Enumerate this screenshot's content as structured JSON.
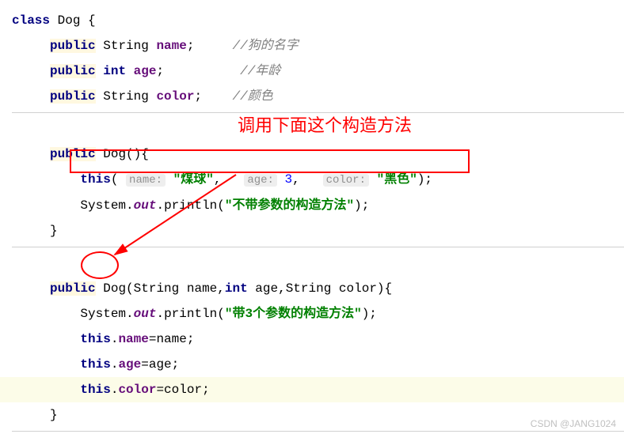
{
  "code": {
    "classDecl": {
      "kw_class": "class",
      "name": "Dog",
      "brace": " {"
    },
    "field1": {
      "pub": "public",
      "type": "String",
      "name": "name",
      "semi": ";",
      "comment": "//狗的名字"
    },
    "field2": {
      "pub": "public",
      "type": "int",
      "name": "age",
      "semi": ";",
      "comment": "//年龄"
    },
    "field3": {
      "pub": "public",
      "type": "String",
      "name": "color",
      "semi": ";",
      "comment": "//颜色"
    },
    "ctor1": {
      "pub": "public",
      "name": "Dog",
      "paren": "(){",
      "thisCall": {
        "kw_this": "this",
        "open": "(",
        "h1": "name:",
        "arg1": "\"煤球\"",
        "c1": ",",
        "h2": "age:",
        "arg2": "3",
        "c2": ",",
        "h3": "color:",
        "arg3": "\"黑色\"",
        "close": ");"
      },
      "println": {
        "sys": "System",
        "dot1": ".",
        "out": "out",
        "dot2": ".",
        "fn": "println",
        "open": "(",
        "arg": "\"不带参数的构造方法\"",
        "close": ");"
      },
      "closeBrace": "}"
    },
    "ctor2": {
      "pub": "public",
      "name": "Dog",
      "sig": "(String name,",
      "kw_int": "int",
      "sig2": " age,String color){",
      "println": {
        "sys": "System",
        "dot1": ".",
        "out": "out",
        "dot2": ".",
        "fn": "println",
        "open": "(",
        "arg": "\"带3个参数的构造方法\"",
        "close": ");"
      },
      "assign1": {
        "kw_this": "this",
        "dot": ".",
        "field": "name",
        "eq": "=name;"
      },
      "assign2": {
        "kw_this": "this",
        "dot": ".",
        "field": "age",
        "eq": "=age;"
      },
      "assign3": {
        "kw_this": "this",
        "dot": ".",
        "field": "color",
        "eq": "=color;"
      },
      "closeBrace": "}"
    }
  },
  "annotation": {
    "label": "调用下面这个构造方法"
  },
  "watermark": "CSDN @JANG1024"
}
